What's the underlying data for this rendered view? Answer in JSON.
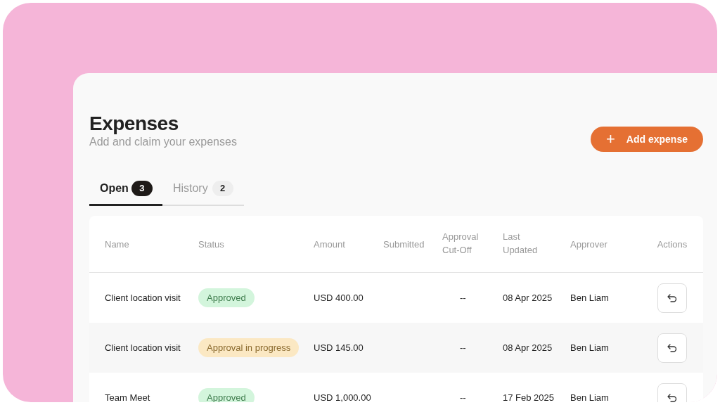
{
  "header": {
    "title": "Expenses",
    "subtitle": "Add and claim your expenses",
    "add_button": {
      "icon": "+",
      "label": "Add expense"
    }
  },
  "tabs": [
    {
      "label": "Open",
      "count": "3",
      "selected": true
    },
    {
      "label": "History",
      "count": "2",
      "selected": false
    }
  ],
  "table": {
    "columns": [
      "Name",
      "Status",
      "Amount",
      "Submitted",
      "Approval Cut-Off",
      "Last Updated",
      "Approver",
      "Actions"
    ],
    "rows": [
      {
        "name": "Client location visit",
        "status": {
          "label": "Approved",
          "kind": "approved"
        },
        "amount": "USD 400.00",
        "cut_off": "--",
        "last_updated": "08 Apr 2025",
        "approver": "Ben Liam"
      },
      {
        "name": "Client location visit",
        "status": {
          "label": "Approval in progress",
          "kind": "pending"
        },
        "amount": "USD 145.00",
        "cut_off": "--",
        "last_updated": "08 Apr 2025",
        "approver": "Ben Liam"
      },
      {
        "name": "Team Meet",
        "status": {
          "label": "Approved",
          "kind": "approved"
        },
        "amount": "USD 1,000.00",
        "cut_off": "--",
        "last_updated": "17 Feb 2025",
        "approver": "Ben Liam"
      }
    ]
  }
}
